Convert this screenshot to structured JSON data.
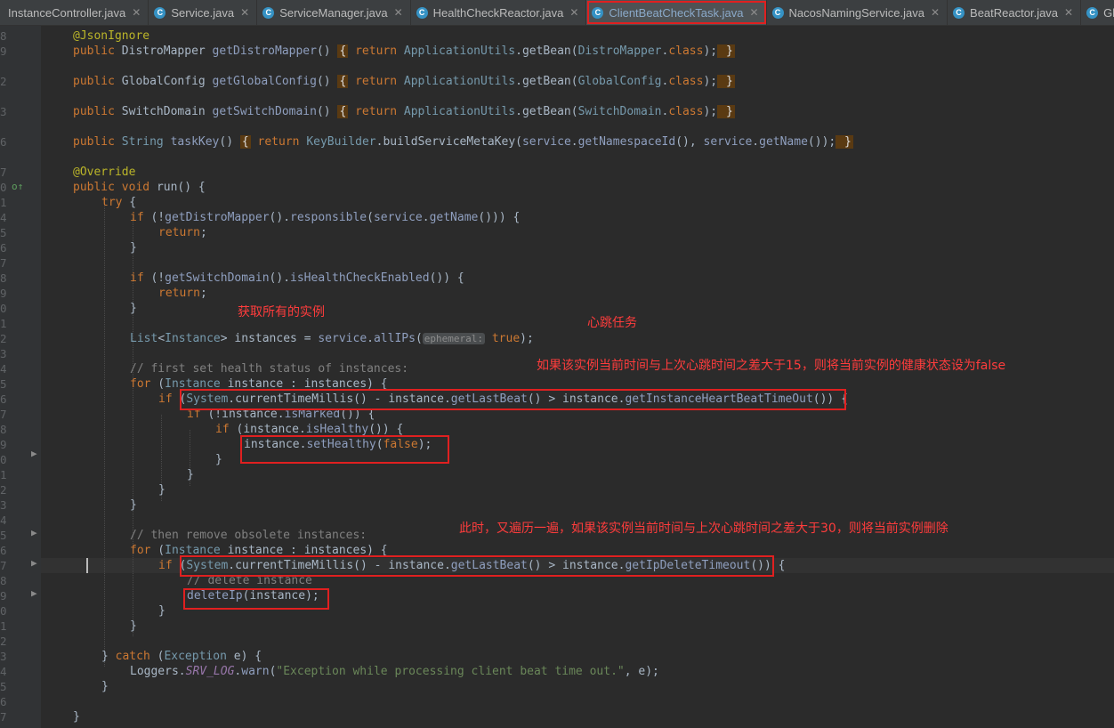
{
  "tabs": [
    {
      "label": "InstanceController.java",
      "active": false
    },
    {
      "label": "Service.java",
      "active": false
    },
    {
      "label": "ServiceManager.java",
      "active": false
    },
    {
      "label": "HealthCheckReactor.java",
      "active": false
    },
    {
      "label": "ClientBeatCheckTask.java",
      "active": true
    },
    {
      "label": "NacosNamingService.java",
      "active": false
    },
    {
      "label": "BeatReactor.java",
      "active": false
    },
    {
      "label": "Global",
      "active": false
    }
  ],
  "gutter": {
    "line_numbers": [
      "8",
      "9",
      "2",
      "3",
      "6",
      "7",
      "0",
      "1",
      "4",
      "5",
      "6",
      "7",
      "8",
      "9",
      "0",
      "1",
      "2",
      "3",
      "4",
      "5",
      "6",
      "7",
      "8",
      "9",
      "0",
      "1",
      "2",
      "3",
      "4",
      "5",
      "6",
      "7",
      "8",
      "9",
      "0",
      "1",
      "2",
      "3",
      "4",
      "5",
      "6",
      "7",
      "8",
      "9",
      "0",
      "1",
      "2",
      "3"
    ]
  },
  "code": {
    "ann_jsonignore": "@JsonIgnore",
    "ann_override": "@Override",
    "kw_public": "public",
    "kw_void": "void",
    "kw_try": "try",
    "kw_if": "if",
    "kw_return": "return",
    "kw_for": "for",
    "kw_catch": "catch",
    "kw_class": "class",
    "kw_false": "false",
    "kw_true": "true",
    "ty_distro": "DistroMapper",
    "ty_global": "GlobalConfig",
    "ty_switch": "SwitchDomain",
    "ty_string": "String",
    "ty_appu": "ApplicationUtils",
    "ty_keyb": "KeyBuilder",
    "ty_list": "List",
    "ty_instance": "Instance",
    "ty_system": "System",
    "ty_exception": "Exception",
    "m_getdistro": "getDistroMapper",
    "m_getglobal": "getGlobalConfig",
    "m_getswitch": "getSwitchDomain",
    "m_taskkey": "taskKey",
    "m_run": "run",
    "m_getbean": "getBean",
    "m_build": "buildServiceMetaKey",
    "m_getns": "getNamespaceId",
    "m_getname": "getName",
    "m_responsible": "responsible",
    "m_hcenabled": "isHealthCheckEnabled",
    "m_allips": "allIPs",
    "m_ctm": "currentTimeMillis",
    "m_getlastbeat": "getLastBeat",
    "m_gethbto": "getInstanceHeartBeatTimeOut",
    "m_ismarked": "isMarked",
    "m_ishealthy": "isHealthy",
    "m_sethealthy": "setHealthy",
    "m_getipdel": "getIpDeleteTimeout",
    "m_deleteip": "deleteIp",
    "m_warn": "warn",
    "f_service": "service",
    "v_instance": "instance",
    "v_instances": "instances",
    "v_e": "e",
    "loggers": "Loggers",
    "srv_log": "SRV_LOG",
    "hint_ephemeral": "ephemeral:",
    "cm_first": "// first set health status of instances:",
    "cm_then": "// then remove obsolete instances:",
    "cm_delete": "// delete instance",
    "str_exception": "\"Exception while processing client beat time out.\""
  },
  "annotations": {
    "get_all_instances": "获取所有的实例",
    "heartbeat_task": "心跳任务",
    "health_rule": "如果该实例当前时间与上次心跳时间之差大于15，则将当前实例的健康状态设为false",
    "delete_rule": "此时，又遍历一遍，如果该实例当前时间与上次心跳时间之差大于30，则将当前实例删除"
  },
  "colors": {
    "editor_bg": "#2b2b2b",
    "keyword": "#cc7832",
    "annotation_red": "#ff3c3c"
  }
}
